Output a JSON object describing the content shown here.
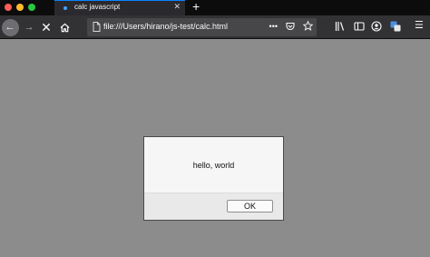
{
  "tab": {
    "title": "calc javascript",
    "close_glyph": "✕",
    "new_tab_glyph": "+"
  },
  "nav": {
    "back_glyph": "←",
    "forward_glyph": "→",
    "stop_glyph": "✕",
    "url": "file:///Users/hirano/js-test/calc.html",
    "more_glyph": "•••",
    "menu_glyph": "☰"
  },
  "dialog": {
    "message": "hello, world",
    "ok_label": "OK"
  },
  "colors": {
    "content_overlay": "#8c8c8c",
    "tab_accent": "#0a84ff",
    "toolbar": "#323234"
  }
}
